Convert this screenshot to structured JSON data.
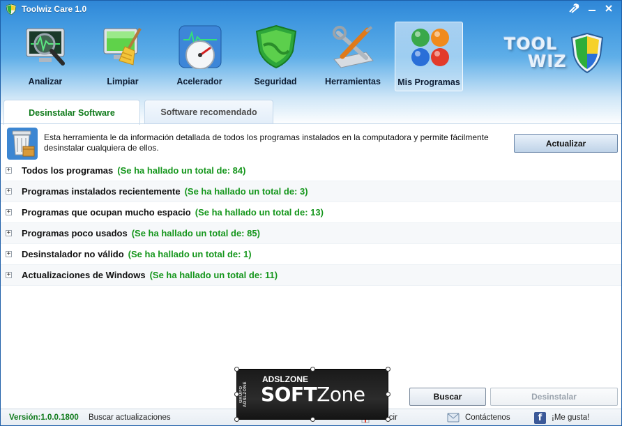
{
  "window": {
    "title": "Toolwiz Care 1.0"
  },
  "nav": {
    "items": [
      {
        "label": "Analizar",
        "icon": "monitor-magnifier-icon"
      },
      {
        "label": "Limpiar",
        "icon": "monitor-broom-icon"
      },
      {
        "label": "Acelerador",
        "icon": "speedometer-icon"
      },
      {
        "label": "Seguridad",
        "icon": "shield-icon"
      },
      {
        "label": "Herramientas",
        "icon": "tools-icon"
      },
      {
        "label": "Mis Programas",
        "icon": "color-tiles-icon",
        "active": true
      }
    ]
  },
  "logo": {
    "line1": "TOOL",
    "line2": "WIZ"
  },
  "tabs": [
    {
      "label": "Desinstalar Software",
      "active": true
    },
    {
      "label": "Software recomendado",
      "active": false
    }
  ],
  "description": {
    "text": "Esta herramienta le da información detallada de todos los programas instalados en la computadora y permite fácilmente desinstalar cualquiera de ellos.",
    "update_button": "Actualizar"
  },
  "categories": [
    {
      "label": "Todos los programas",
      "count": "(Se ha hallado un total de: 84)"
    },
    {
      "label": "Programas instalados recientemente",
      "count": "(Se ha hallado un total de: 3)"
    },
    {
      "label": "Programas que ocupan mucho espacio",
      "count": "(Se ha hallado un total de: 13)"
    },
    {
      "label": "Programas poco usados",
      "count": "(Se ha hallado un total de: 85)"
    },
    {
      "label": "Desinstalador no válido",
      "count": "(Se ha hallado un total de: 1)"
    },
    {
      "label": "Actualizaciones de Windows",
      "count": "(Se ha hallado un total de: 11)"
    }
  ],
  "actions": {
    "search": "Buscar",
    "uninstall": "Desinstalar"
  },
  "status": {
    "version": "Versión:1.0.0.1800",
    "check_updates": "Buscar actualizaciones",
    "feedback": "ducir",
    "contact": "Contáctenos",
    "like": "¡Me gusta!"
  },
  "watermark": {
    "side": "GRUPO ADSLZONE",
    "top": "ADSLZONE",
    "brand_a": "SOFT",
    "brand_b": "Zone"
  },
  "colors": {
    "accent_green": "#15961c",
    "title_blue": "#2f86d6"
  }
}
